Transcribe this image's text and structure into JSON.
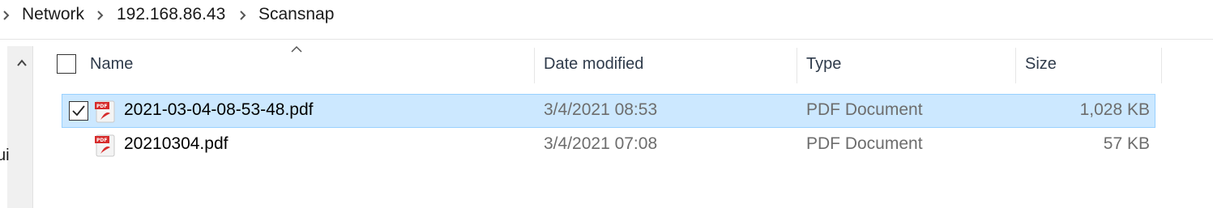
{
  "breadcrumb": {
    "items": [
      {
        "label": "Network"
      },
      {
        "label": "192.168.86.43"
      },
      {
        "label": "Scansnap"
      }
    ]
  },
  "nav": {
    "partial_text": "ui"
  },
  "columns": {
    "name": "Name",
    "date_modified": "Date modified",
    "type": "Type",
    "size": "Size"
  },
  "files": [
    {
      "name": "2021-03-04-08-53-48.pdf",
      "date": "3/4/2021 08:53",
      "type": "PDF Document",
      "size": "1,028 KB",
      "selected": true,
      "icon": "pdf-icon"
    },
    {
      "name": "20210304.pdf",
      "date": "3/4/2021 07:08",
      "type": "PDF Document",
      "size": "57 KB",
      "selected": false,
      "icon": "pdf-icon"
    }
  ],
  "colors": {
    "selection_bg": "#cce8ff",
    "selection_border": "#99d1ff",
    "pdf_red": "#d62b2b"
  }
}
